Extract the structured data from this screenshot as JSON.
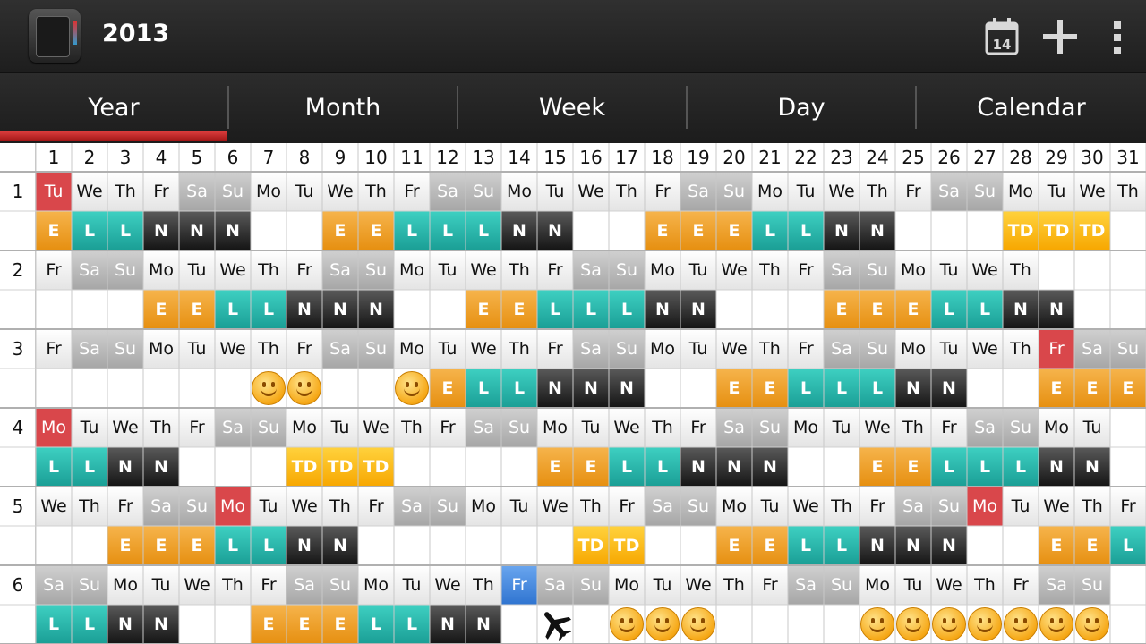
{
  "header": {
    "title": "2013",
    "app_icon": "planner-book-icon",
    "today_label": "14",
    "actions": [
      "calendar-today-icon",
      "plus-icon",
      "overflow-menu-icon"
    ]
  },
  "tabs": [
    {
      "label": "Year",
      "active": true
    },
    {
      "label": "Month",
      "active": false
    },
    {
      "label": "Week",
      "active": false
    },
    {
      "label": "Day",
      "active": false
    },
    {
      "label": "Calendar",
      "active": false
    }
  ],
  "colors": {
    "E": "#ee9f22",
    "L": "#26b3a9",
    "N": "#2a2a2a",
    "TD": "#fbb814",
    "weekend": "#b8b8b8",
    "highlight_red": "#d9474b",
    "today_blue": "#3f82db",
    "tab_indicator": "#c62828"
  },
  "day_headers": [
    "1",
    "2",
    "3",
    "4",
    "5",
    "6",
    "7",
    "8",
    "9",
    "10",
    "11",
    "12",
    "13",
    "14",
    "15",
    "16",
    "17",
    "18",
    "19",
    "20",
    "21",
    "22",
    "23",
    "24",
    "25",
    "26",
    "27",
    "28",
    "29",
    "30",
    "31"
  ],
  "months": [
    {
      "label": "1",
      "days": [
        "Tu",
        "We",
        "Th",
        "Fr",
        "Sa",
        "Su",
        "Mo",
        "Tu",
        "We",
        "Th",
        "Fr",
        "Sa",
        "Su",
        "Mo",
        "Tu",
        "We",
        "Th",
        "Fr",
        "Sa",
        "Su",
        "Mo",
        "Tu",
        "We",
        "Th",
        "Fr",
        "Sa",
        "Su",
        "Mo",
        "Tu",
        "We",
        "Th"
      ],
      "red": [
        1
      ],
      "blue": [],
      "shifts": [
        "E",
        "L",
        "L",
        "N",
        "N",
        "N",
        "",
        "",
        "E",
        "E",
        "L",
        "L",
        "L",
        "N",
        "N",
        "",
        "",
        "E",
        "E",
        "E",
        "L",
        "L",
        "N",
        "N",
        "",
        "",
        "",
        "TD",
        "TD",
        "TD",
        ""
      ]
    },
    {
      "label": "2",
      "days": [
        "Fr",
        "Sa",
        "Su",
        "Mo",
        "Tu",
        "We",
        "Th",
        "Fr",
        "Sa",
        "Su",
        "Mo",
        "Tu",
        "We",
        "Th",
        "Fr",
        "Sa",
        "Su",
        "Mo",
        "Tu",
        "We",
        "Th",
        "Fr",
        "Sa",
        "Su",
        "Mo",
        "Tu",
        "We",
        "Th",
        "",
        "",
        ""
      ],
      "red": [],
      "blue": [],
      "shifts": [
        "",
        "",
        "",
        "E",
        "E",
        "L",
        "L",
        "N",
        "N",
        "N",
        "",
        "",
        "E",
        "E",
        "L",
        "L",
        "L",
        "N",
        "N",
        "",
        "",
        "",
        "E",
        "E",
        "E",
        "L",
        "L",
        "N",
        "N",
        "",
        ""
      ]
    },
    {
      "label": "3",
      "days": [
        "Fr",
        "Sa",
        "Su",
        "Mo",
        "Tu",
        "We",
        "Th",
        "Fr",
        "Sa",
        "Su",
        "Mo",
        "Tu",
        "We",
        "Th",
        "Fr",
        "Sa",
        "Su",
        "Mo",
        "Tu",
        "We",
        "Th",
        "Fr",
        "Sa",
        "Su",
        "Mo",
        "Tu",
        "We",
        "Th",
        "Fr",
        "Sa",
        "Su"
      ],
      "red": [
        29
      ],
      "blue": [],
      "shifts": [
        "",
        "",
        "",
        "",
        "",
        "",
        "smiley",
        "smiley",
        "",
        "",
        "smiley",
        "E",
        "L",
        "L",
        "N",
        "N",
        "N",
        "",
        "",
        "E",
        "E",
        "L",
        "L",
        "L",
        "N",
        "N",
        "",
        "",
        "E",
        "E",
        "E"
      ]
    },
    {
      "label": "4",
      "days": [
        "Mo",
        "Tu",
        "We",
        "Th",
        "Fr",
        "Sa",
        "Su",
        "Mo",
        "Tu",
        "We",
        "Th",
        "Fr",
        "Sa",
        "Su",
        "Mo",
        "Tu",
        "We",
        "Th",
        "Fr",
        "Sa",
        "Su",
        "Mo",
        "Tu",
        "We",
        "Th",
        "Fr",
        "Sa",
        "Su",
        "Mo",
        "Tu",
        ""
      ],
      "red": [
        1
      ],
      "blue": [],
      "shifts": [
        "L",
        "L",
        "N",
        "N",
        "",
        "",
        "",
        "TD",
        "TD",
        "TD",
        "",
        "",
        "",
        "",
        "E",
        "E",
        "L",
        "L",
        "N",
        "N",
        "N",
        "",
        "",
        "E",
        "E",
        "L",
        "L",
        "L",
        "N",
        "N",
        ""
      ]
    },
    {
      "label": "5",
      "days": [
        "We",
        "Th",
        "Fr",
        "Sa",
        "Su",
        "Mo",
        "Tu",
        "We",
        "Th",
        "Fr",
        "Sa",
        "Su",
        "Mo",
        "Tu",
        "We",
        "Th",
        "Fr",
        "Sa",
        "Su",
        "Mo",
        "Tu",
        "We",
        "Th",
        "Fr",
        "Sa",
        "Su",
        "Mo",
        "Tu",
        "We",
        "Th",
        "Fr"
      ],
      "red": [
        6,
        27
      ],
      "blue": [],
      "shifts": [
        "",
        "",
        "E",
        "E",
        "E",
        "L",
        "L",
        "N",
        "N",
        "",
        "",
        "",
        "",
        "",
        "",
        "TD",
        "TD",
        "",
        "",
        "E",
        "E",
        "L",
        "L",
        "N",
        "N",
        "N",
        "",
        "",
        "E",
        "E",
        "L"
      ]
    },
    {
      "label": "6",
      "days": [
        "Sa",
        "Su",
        "Mo",
        "Tu",
        "We",
        "Th",
        "Fr",
        "Sa",
        "Su",
        "Mo",
        "Tu",
        "We",
        "Th",
        "Fr",
        "Sa",
        "Su",
        "Mo",
        "Tu",
        "We",
        "Th",
        "Fr",
        "Sa",
        "Su",
        "Mo",
        "Tu",
        "We",
        "Th",
        "Fr",
        "Sa",
        "Su",
        ""
      ],
      "red": [],
      "blue": [
        14
      ],
      "shifts": [
        "L",
        "L",
        "N",
        "N",
        "",
        "",
        "E",
        "E",
        "E",
        "L",
        "L",
        "N",
        "N",
        "",
        "plane",
        "",
        "smiley",
        "smiley",
        "smiley",
        "",
        "",
        "",
        "",
        "smiley",
        "smiley",
        "smiley",
        "smiley",
        "smiley",
        "smiley",
        "smiley",
        ""
      ]
    }
  ]
}
